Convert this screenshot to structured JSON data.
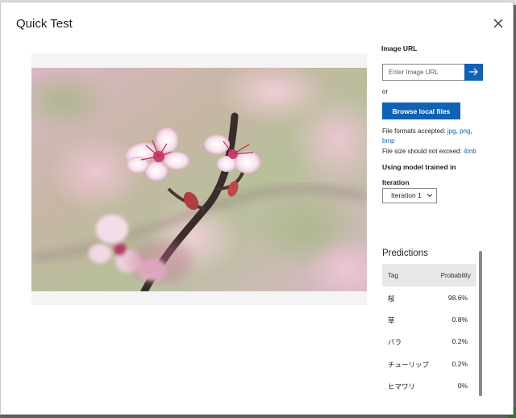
{
  "dialog": {
    "title": "Quick Test",
    "close_icon": "close-icon"
  },
  "image_url": {
    "label": "Image URL",
    "placeholder": "Enter Image URL",
    "submit_icon": "arrow-right-icon"
  },
  "or_text": "or",
  "browse_label": "Browse local files",
  "file_formats": {
    "prefix": "File formats accepted: ",
    "jpg": "jpg",
    "sep1": ", ",
    "png": "png",
    "sep2": ",",
    "bmp": "bmp"
  },
  "file_size": {
    "prefix": "File size should not exceed: ",
    "value": "4mb"
  },
  "model_text": "Using model trained in",
  "iteration": {
    "label": "Iteration",
    "selected": "Iteration 1"
  },
  "predictions": {
    "title": "Predictions",
    "columns": {
      "tag": "Tag",
      "probability": "Probability"
    },
    "rows": [
      {
        "tag": "桜",
        "probability": "98.6%"
      },
      {
        "tag": "草",
        "probability": "0.8%"
      },
      {
        "tag": "バラ",
        "probability": "0.2%"
      },
      {
        "tag": "チューリップ",
        "probability": "0.2%"
      },
      {
        "tag": "ヒマワリ",
        "probability": "0%"
      }
    ]
  },
  "colors": {
    "accent": "#0f62b4",
    "header_bg": "#e8e8e8"
  }
}
